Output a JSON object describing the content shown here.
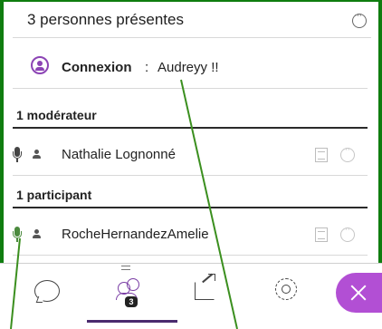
{
  "panel": {
    "title": "3 personnes présentes",
    "more_icon": "ellipsis-circle-icon"
  },
  "current_user": {
    "label": "Connexion",
    "separator": ":",
    "name": "Audreyy !!",
    "icon": "user-circle-icon"
  },
  "sections": [
    {
      "heading": "1 modérateur",
      "users": [
        {
          "name": "Nathalie Lognonné",
          "mic": "gray"
        }
      ]
    },
    {
      "heading": "1 participant",
      "users": [
        {
          "name": "RocheHernandezAmelie",
          "mic": "green"
        }
      ]
    }
  ],
  "tabbar": {
    "tabs": [
      {
        "id": "chat",
        "icon": "chat-bubble-icon"
      },
      {
        "id": "attendees",
        "icon": "users-icon",
        "badge": "3",
        "active": true
      },
      {
        "id": "share",
        "icon": "share-icon"
      },
      {
        "id": "settings",
        "icon": "gear-icon"
      }
    ],
    "close_icon": "close-icon"
  },
  "colors": {
    "accent_purple": "#b24fd4",
    "icon_purple": "#8c44b5",
    "annotation_green": "#0f7d0f",
    "mic_green": "#4b8a3e"
  }
}
